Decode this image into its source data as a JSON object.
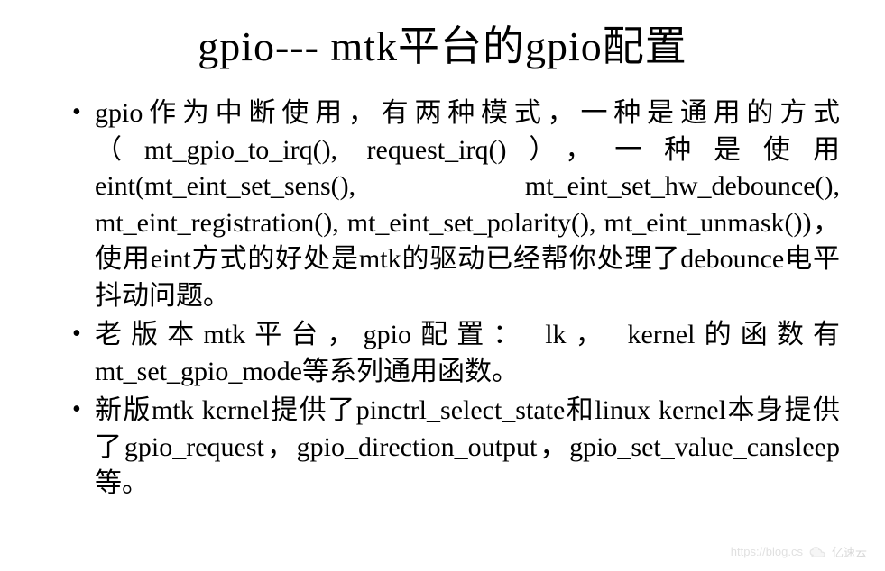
{
  "slide": {
    "title": "gpio--- mtk平台的gpio配置",
    "bullets": [
      "gpio作为中断使用，有两种模式，一种是通用的方式（mt_gpio_to_irq(), request_irq()），一种是使用eint(mt_eint_set_sens(), mt_eint_set_hw_debounce(), mt_eint_registration(), mt_eint_set_polarity(), mt_eint_unmask())，使用eint方式的好处是mtk的驱动已经帮你处理了debounce电平抖动问题。",
      "老版本mtk平台，gpio配置： lk， kernel的函数有mt_set_gpio_mode等系列通用函数。",
      "新版mtk kernel提供了pinctrl_select_state和linux kernel本身提供了gpio_request，gpio_direction_output，gpio_set_value_cansleep等。"
    ]
  },
  "watermark": {
    "url": "https://blog.cs",
    "brand": "亿速云"
  }
}
